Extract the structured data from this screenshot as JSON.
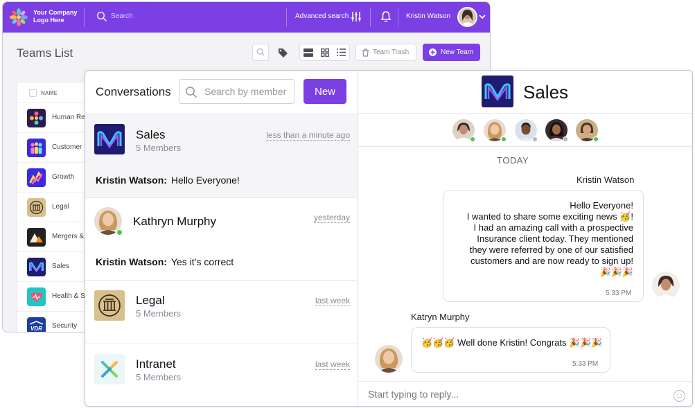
{
  "colors": {
    "accent": "#7b3fe4",
    "online": "#4cc54b",
    "offline": "#b5b5bf"
  },
  "topbar": {
    "logo_line1": "Your Company",
    "logo_line2": "Logo Here",
    "search_placeholder": "Search",
    "advanced_search": "Advanced search",
    "user_name": "Kristin Watson"
  },
  "teams_page": {
    "title": "Teams List",
    "team_trash": "Team Trash",
    "new_team": "New Team",
    "name_header": "NAME",
    "teams": [
      {
        "label": "Human Res",
        "icon": "flower-logo-icon"
      },
      {
        "label": "Customer S",
        "icon": "people-logo-icon"
      },
      {
        "label": "Growth",
        "icon": "growth-logo-icon"
      },
      {
        "label": "Legal",
        "icon": "pillar-logo-icon"
      },
      {
        "label": "Mergers & A",
        "icon": "mountain-logo-icon"
      },
      {
        "label": "Sales",
        "icon": "sales-wave-logo-icon"
      },
      {
        "label": "Health & Sa",
        "icon": "heart-logo-icon"
      },
      {
        "label": "Security",
        "icon": "vdr-logo-icon"
      }
    ]
  },
  "conversations": {
    "title": "Conversations",
    "search_placeholder": "Search by member",
    "new_button": "New",
    "items": [
      {
        "name": "Sales",
        "members": "5 Members",
        "time": "less than a minute ago",
        "sender": "Kristin Watson:",
        "message": "Hello Everyone!"
      },
      {
        "name": "Kathryn Murphy",
        "time": "yesterday",
        "sender": "Kristin Watson:",
        "message": "Yes it’s correct"
      },
      {
        "name": "Legal",
        "members": "5 Members",
        "time": "last week"
      },
      {
        "name": "Intranet",
        "members": "5 Members",
        "time": "last week"
      }
    ]
  },
  "chat": {
    "title": "Sales",
    "day_label": "TODAY",
    "messages": [
      {
        "sender": "Kristin Watson",
        "text": "Hello Everyone!\nI wanted to share some exciting news 🥳!\nI had an amazing call with a prospective\nInsurance client today. They mentioned\nthey were referred by one of our satisfied\ncustomers and are now ready to sign up!\n🎉🎉🎉",
        "time": "5:33 PM"
      },
      {
        "sender": "Katryn Murphy",
        "text": "🥳🥳🥳 Well done Kristin! Congrats 🎉🎉🎉",
        "time": "5:33 PM"
      }
    ],
    "reply_placeholder": "Start typing to reply..."
  }
}
